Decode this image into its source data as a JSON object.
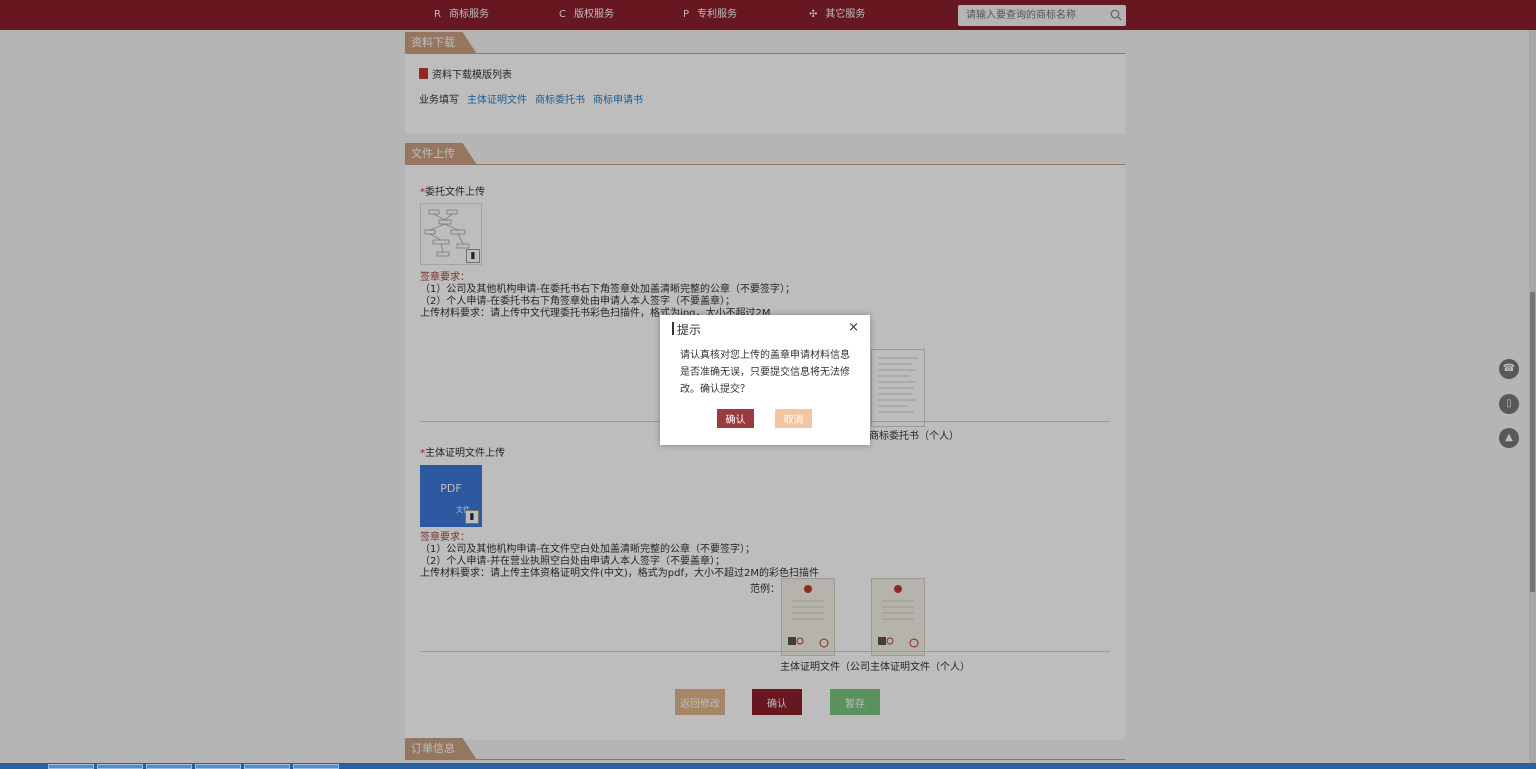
{
  "nav": {
    "items": [
      {
        "icon_text": "R",
        "label": "商标服务"
      },
      {
        "icon_text": "C",
        "label": "版权服务"
      },
      {
        "icon_text": "P",
        "label": "专利服务"
      },
      {
        "icon_text": "✣",
        "label": "其它服务"
      }
    ],
    "search_placeholder": "请输入要查询的商标名称"
  },
  "download": {
    "tab_label": "资料下载",
    "list_title": "资料下载模版列表",
    "biz_label": "业务填写",
    "links": [
      "主体证明文件",
      "商标委托书",
      "商标申请书"
    ]
  },
  "upload": {
    "tab_label": "文件上传",
    "section1": {
      "star": "*",
      "label": "委托文件上传",
      "req_title": "签章要求：",
      "req_lines": [
        "（1）公司及其他机构申请-在委托书右下角签章处加盖清晰完整的公章（不要签字）；",
        "（2）个人申请-在委托书右下角签章处由申请人本人签字（不要盖章）；",
        "上传材料要求：请上传中文代理委托书彩色扫描件，格式为jpg，大小不超过2M"
      ],
      "sample_caption": "商标委托书（个人）"
    },
    "section2": {
      "star": "*",
      "label": "主体证明文件上传",
      "pdf_title": "PDF",
      "pdf_sub": "文件",
      "req_title": "签章要求：",
      "req_lines": [
        "（1）公司及其他机构申请-在文件空白处加盖清晰完整的公章（不要签字）；",
        "（2）个人申请-并在营业执照空白处由申请人本人签字（不要盖章）；",
        "上传材料要求：请上传主体资格证明文件(中文)，格式为pdf，大小不超过2M的彩色扫描件"
      ],
      "sample_label": "范例：",
      "sample_caption_company": "主体证明文件（公司",
      "sample_caption_person": "主体证明文件（个人）"
    },
    "buttons": {
      "back": "返回修改",
      "confirm": "确认",
      "save": "暂存"
    }
  },
  "order": {
    "tab_label": "订单信息"
  },
  "modal": {
    "title": "提示",
    "close": "×",
    "message": "请认真核对您上传的盖章申请材料信息\n是否准确无误，只要提交信息将无法修\n改。确认提交？",
    "ok": "确认",
    "cancel": "取消"
  },
  "colors": {
    "nav_bg": "#8a1f2b",
    "tab_bg": "#c9a183",
    "confirm": "#9b3a3f",
    "cancel": "#f1c6a3",
    "save": "#7bc47f",
    "back": "#e2b48c"
  }
}
